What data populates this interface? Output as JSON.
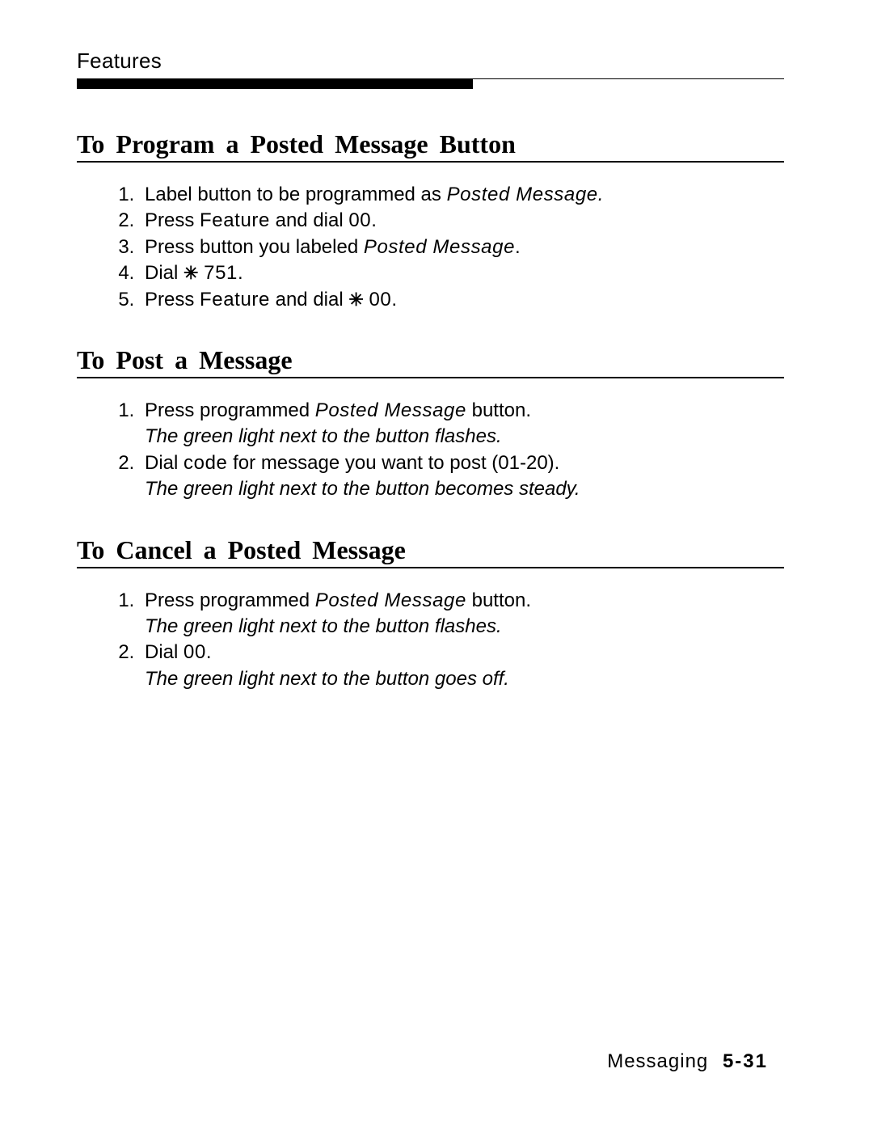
{
  "header": {
    "label": "Features"
  },
  "sections": {
    "program": {
      "title": "To Program a Posted Message Button",
      "steps": {
        "s1a": "Label button to be programmed as ",
        "s1b": "Posted Message.",
        "s2a": "Press ",
        "s2b": "Feature",
        "s2c": " and dial ",
        "s2d": "00.",
        "s3a": "Press button you labeled ",
        "s3b": "Posted Message",
        "s3c": ".",
        "s4a": "Dial ",
        "s4b": "751.",
        "s5a": "Press ",
        "s5b": "Feature",
        "s5c": " and dial ",
        "s5d": "00."
      }
    },
    "post": {
      "title": "To Post a Message",
      "steps": {
        "s1a": "Press programmed ",
        "s1b": "Posted Message",
        "s1c": " button.",
        "n1": "The green light next to the button flashes.",
        "s2a": "Dial ",
        "s2b": "code",
        "s2c": " for message you want to post (01-20).",
        "n2": "The green light next to the button becomes steady."
      }
    },
    "cancel": {
      "title": "To Cancel a Posted Message",
      "steps": {
        "s1a": "Press programmed ",
        "s1b": "Posted Message",
        "s1c": " button.",
        "n1": "The green light next to the button flashes.",
        "s2a": "Dial ",
        "s2b": "00.",
        "n2": "The green light next to the button goes off."
      }
    }
  },
  "footer": {
    "section": "Messaging",
    "page": "5-31"
  },
  "glyphs": {
    "star": "✳"
  }
}
